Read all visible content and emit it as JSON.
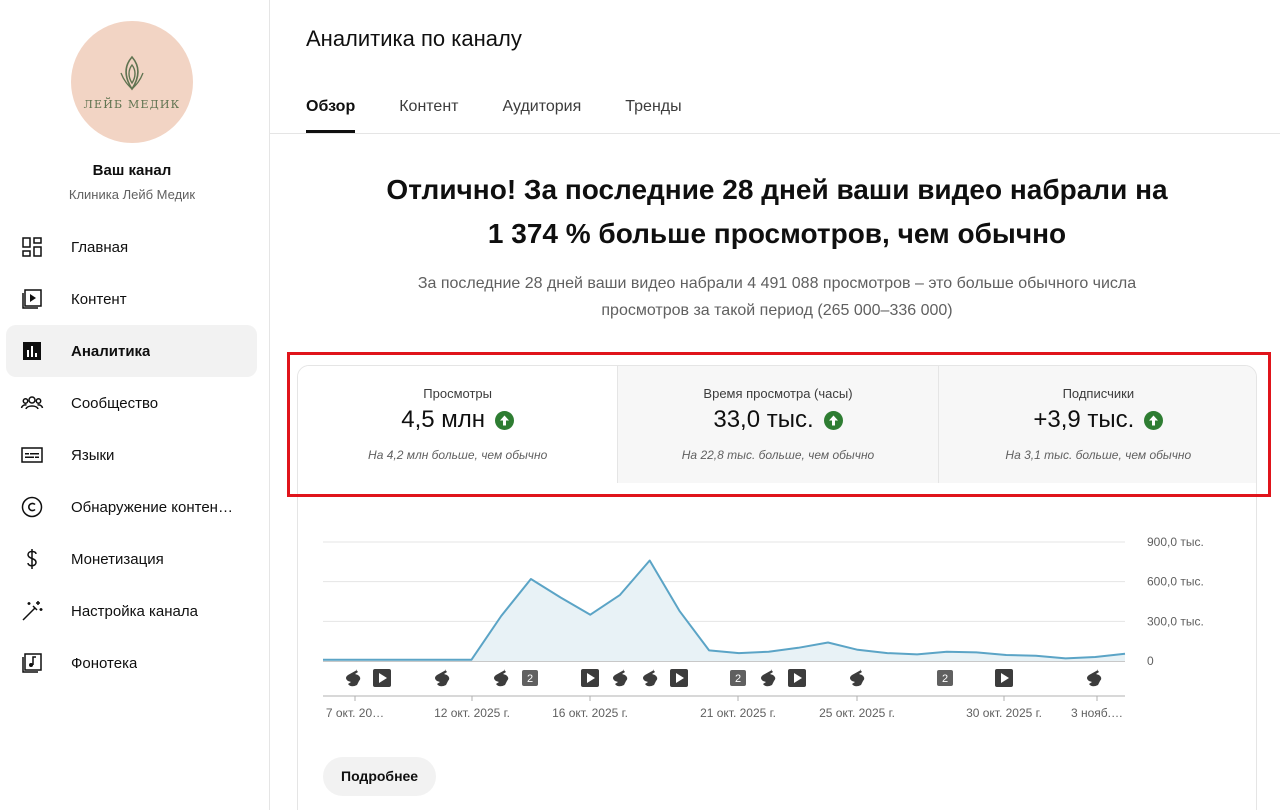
{
  "sidebar": {
    "logo_text": "ЛЕЙБ МЕДИК",
    "channel_title": "Ваш канал",
    "channel_name": "Клиника Лейб Медик",
    "items": [
      {
        "label": "Главная",
        "icon": "dashboard-icon",
        "active": false
      },
      {
        "label": "Контент",
        "icon": "content-icon",
        "active": false
      },
      {
        "label": "Аналитика",
        "icon": "analytics-icon",
        "active": true
      },
      {
        "label": "Сообщество",
        "icon": "community-icon",
        "active": false
      },
      {
        "label": "Языки",
        "icon": "subtitles-icon",
        "active": false
      },
      {
        "label": "Обнаружение контен…",
        "icon": "copyright-icon",
        "active": false
      },
      {
        "label": "Монетизация",
        "icon": "dollar-icon",
        "active": false
      },
      {
        "label": "Настройка канала",
        "icon": "magic-wand-icon",
        "active": false
      },
      {
        "label": "Фонотека",
        "icon": "audio-library-icon",
        "active": false
      }
    ]
  },
  "header": {
    "title": "Аналитика по каналу",
    "tabs": [
      "Обзор",
      "Контент",
      "Аудитория",
      "Тренды"
    ],
    "active_tab": 0
  },
  "summary": {
    "headline_1": "Отлично! За последние 28 дней ваши видео набрали на",
    "headline_2": "1 374 % больше просмотров, чем обычно",
    "subline_1": "За последние 28 дней ваши видео набрали 4 491 088 просмотров – это больше обычного числа",
    "subline_2": "просмотров за такой период (265 000–336 000)"
  },
  "metrics": [
    {
      "label": "Просмотры",
      "value": "4,5 млн",
      "note": "На 4,2 млн больше, чем обычно"
    },
    {
      "label": "Время просмотра (часы)",
      "value": "33,0 тыс.",
      "note": "На 22,8 тыс. больше, чем обычно"
    },
    {
      "label": "Подписчики",
      "value": "+3,9 тыс.",
      "note": "На 3,1 тыс. больше, чем обычно"
    }
  ],
  "chart_data": {
    "type": "area",
    "y_ticks": [
      "0",
      "300,0 тыс.",
      "600,0 тыс.",
      "900,0 тыс."
    ],
    "ylim": [
      0,
      900000
    ],
    "x_tick_labels": [
      "7 окт. 20…",
      "12 окт. 2025 г.",
      "16 окт. 2025 г.",
      "21 окт. 2025 г.",
      "25 окт. 2025 г.",
      "30 окт. 2025 г.",
      "3 нояб.…"
    ],
    "values": [
      10000,
      10000,
      10000,
      10000,
      10000,
      10000,
      340000,
      620000,
      480000,
      350000,
      500000,
      760000,
      380000,
      80000,
      60000,
      70000,
      100000,
      140000,
      85000,
      60000,
      50000,
      70000,
      65000,
      45000,
      40000,
      20000,
      30000,
      55000
    ],
    "color": "#5ba4c6",
    "markers": [
      "shorts",
      "video",
      "shorts",
      "shorts",
      "multi-2",
      "video",
      "shorts",
      "shorts",
      "video",
      "multi-2",
      "shorts",
      "video",
      "shorts",
      "multi-2",
      "video",
      "shorts"
    ]
  },
  "actions": {
    "more_label": "Подробнее"
  },
  "colors": {
    "up_green": "#2e7d32",
    "highlight_red": "#e0141b"
  }
}
